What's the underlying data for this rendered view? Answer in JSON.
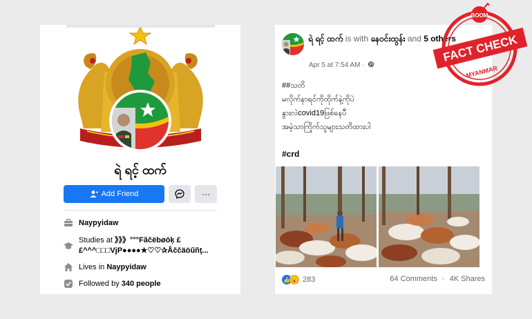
{
  "profile": {
    "name": "ရဲ ရင့် ထက်",
    "add_friend_label": "Add Friend",
    "more_label": "···"
  },
  "intro": {
    "location": "Naypyidaw",
    "studies_prefix": "Studies at ",
    "studies_line1": "》》》°°°Fãčëbøōķ £",
    "studies_line2": "£^^^□□□VjP●●●●★♡♡✰Åččäöűñţ...",
    "lives_prefix": "Lives in ",
    "lives_value": "Naypyidaw",
    "followed_prefix": "Followed by ",
    "followed_value": "340 people"
  },
  "post": {
    "author": "ရဲ ရင့် ထက်",
    "with_text": " is with ",
    "tagged": "နေဝင်းထွန်း",
    "and_text": " and ",
    "others": "5 others",
    "time": "Apr 5 at 7:54 AM ·",
    "line1": "##သတိ",
    "line2": "မလိုက်နာရင်ကိုထိုက်နဲ့ကိုပဲ",
    "line3": "နွားလဲcovid19ဖြစ်နေပီ",
    "line4": "အမဲ့သာကြိုက်သူများသတိထားပါ",
    "hashtag": "#crd",
    "reactions": "283",
    "comments": "64 Comments",
    "dot": "·",
    "shares": "4K Shares"
  },
  "badge": {
    "top": "BOOM",
    "main": "FACT CHECK",
    "bottom": "MYANMAR"
  },
  "colors": {
    "brand_blue": "#1877f2",
    "badge_red": "#e0232b",
    "flag_green": "#1e9a3c",
    "flag_red": "#e0322e",
    "flag_yellow": "#f4c20d"
  }
}
